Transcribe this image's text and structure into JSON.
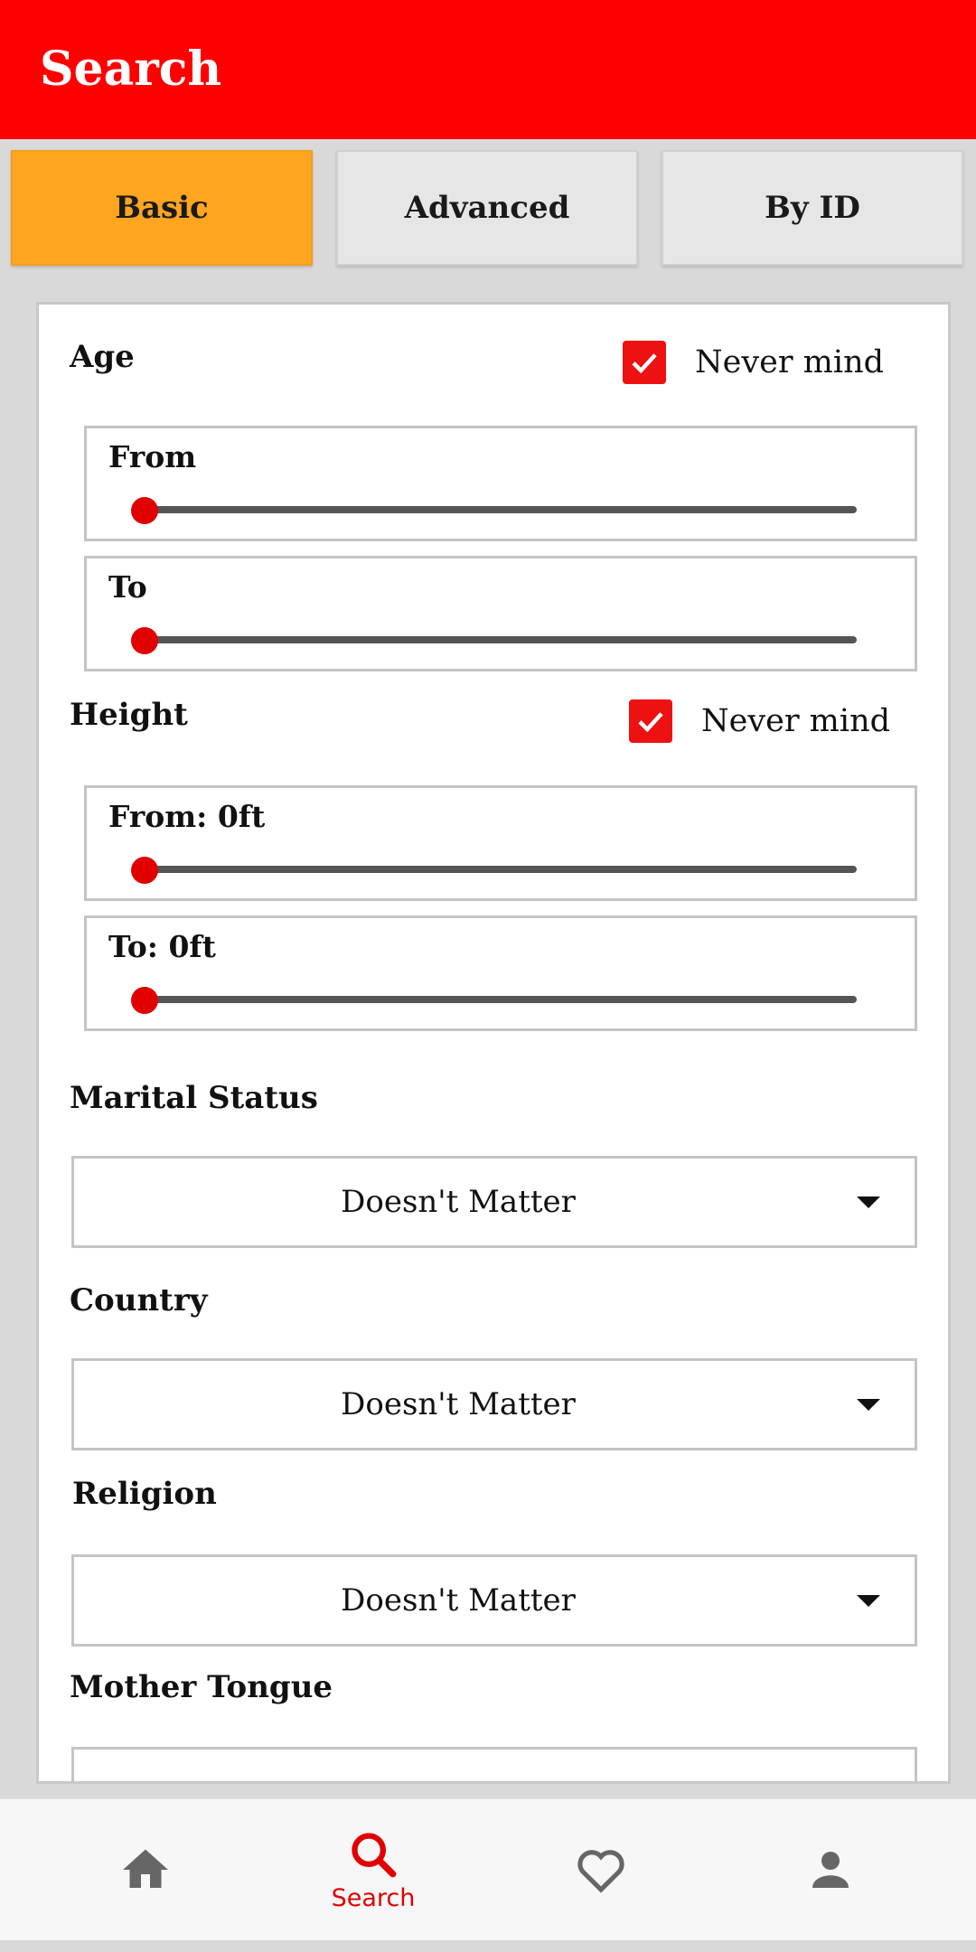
{
  "appbar": {
    "title": "Search",
    "color": "#ff0000"
  },
  "tabs": [
    {
      "label": "Basic",
      "active": true
    },
    {
      "label": "Advanced",
      "active": false
    },
    {
      "label": "By ID",
      "active": false
    }
  ],
  "age": {
    "label": "Age",
    "never_mind": {
      "label": "Never mind",
      "checked": true
    },
    "from": {
      "label": "From",
      "value_fraction": 0
    },
    "to": {
      "label": "To",
      "value_fraction": 0
    }
  },
  "height": {
    "label": "Height",
    "never_mind": {
      "label": "Never mind",
      "checked": true
    },
    "from": {
      "label": "From: 0ft",
      "value_fraction": 0
    },
    "to": {
      "label": "To: 0ft",
      "value_fraction": 0
    }
  },
  "marital_status": {
    "label": "Marital Status",
    "selected": "Doesn't Matter"
  },
  "country": {
    "label": "Country",
    "selected": "Doesn't Matter"
  },
  "religion": {
    "label": "Religion",
    "selected": "Doesn't Matter"
  },
  "mother_tongue": {
    "label": "Mother Tongue"
  },
  "bottom_nav": {
    "items": [
      {
        "icon": "home-icon",
        "label": ""
      },
      {
        "icon": "search-icon",
        "label": "Search",
        "active": true
      },
      {
        "icon": "heart-icon",
        "label": ""
      },
      {
        "icon": "person-icon",
        "label": ""
      }
    ]
  },
  "colors": {
    "accent": "#ff0000",
    "active_tab": "#ffa520",
    "inactive_icon": "#666666"
  }
}
